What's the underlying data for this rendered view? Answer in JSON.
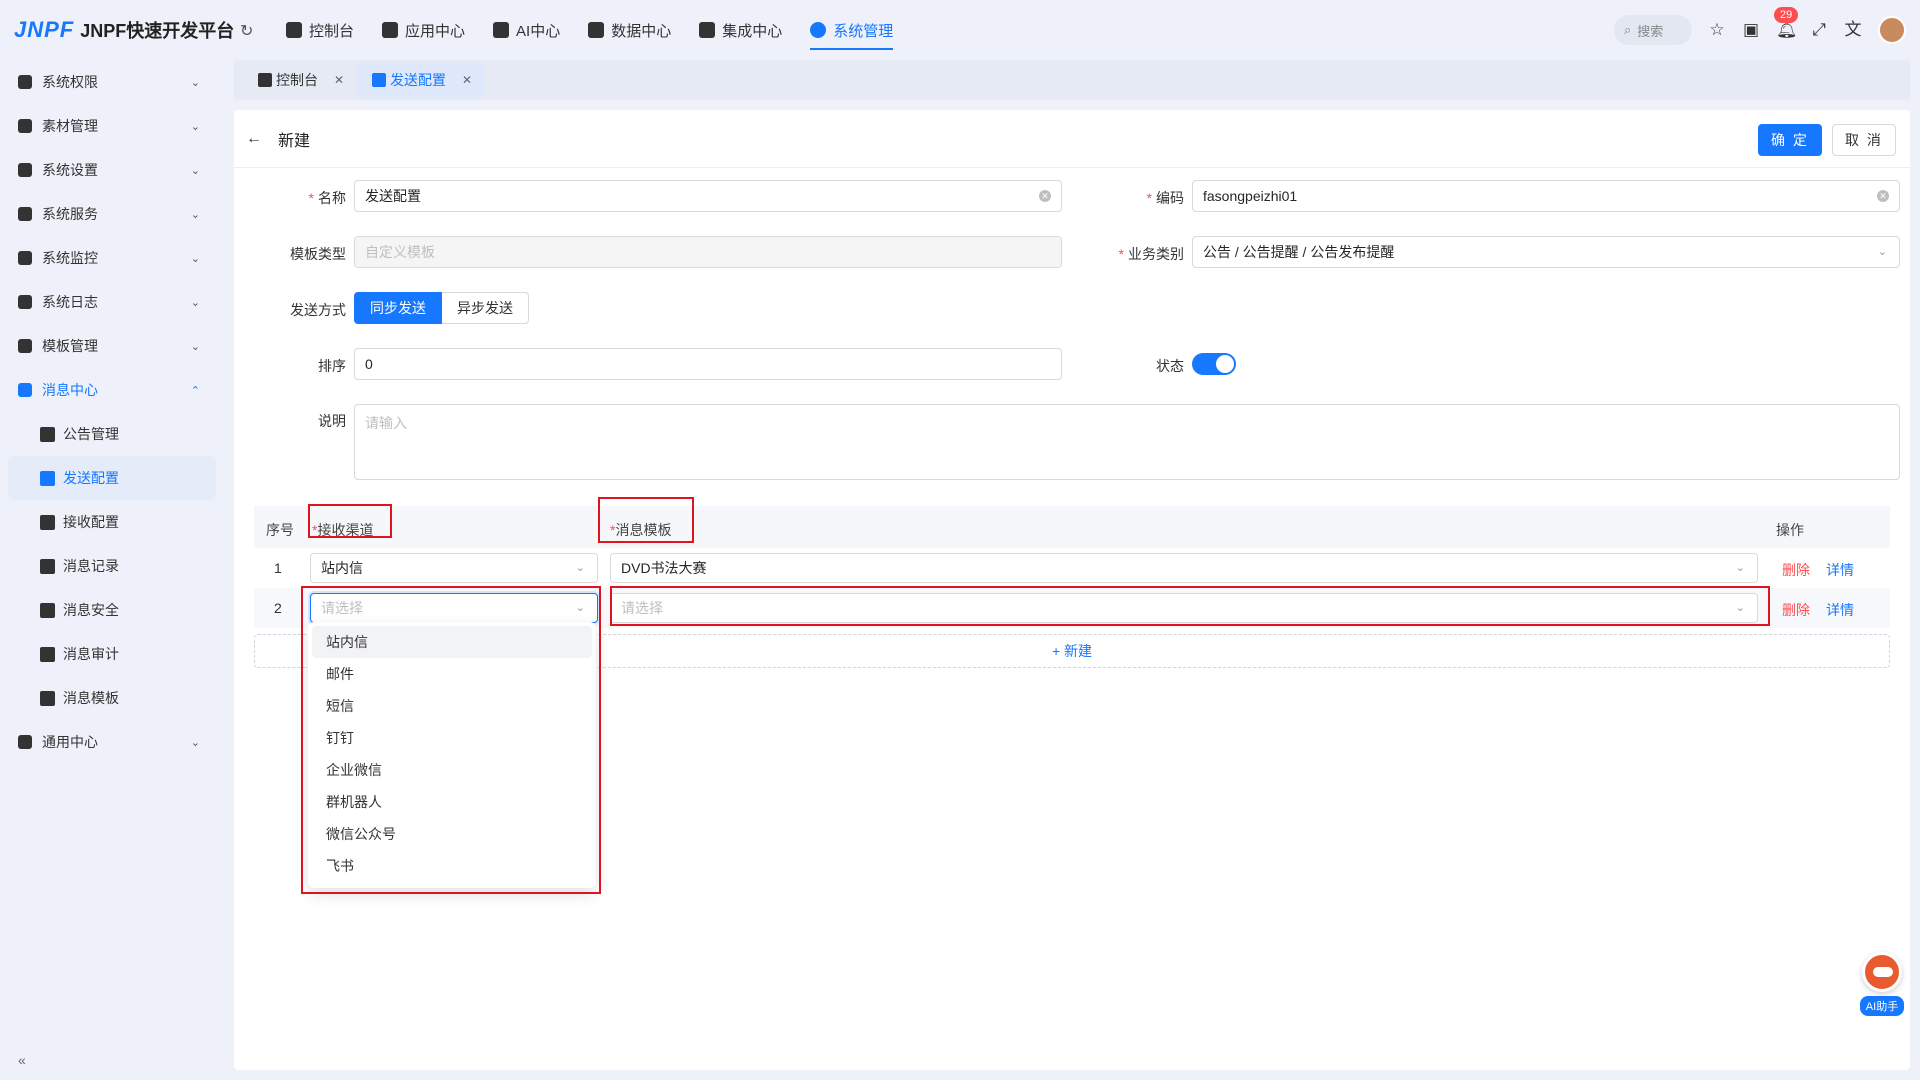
{
  "app": {
    "logo": "JNPF",
    "title": "JNPF快速开发平台"
  },
  "nav": [
    {
      "label": "控制台",
      "icon": "home-icon"
    },
    {
      "label": "应用中心",
      "icon": "app-grid-icon"
    },
    {
      "label": "AI中心",
      "icon": "ai-grid-icon"
    },
    {
      "label": "数据中心",
      "icon": "database-icon"
    },
    {
      "label": "集成中心",
      "icon": "integration-icon"
    },
    {
      "label": "系统管理",
      "icon": "gear-icon",
      "active": true
    }
  ],
  "top_right": {
    "search_placeholder": "搜索",
    "notification_count": "29"
  },
  "sidebar": {
    "items": [
      {
        "label": "系统权限",
        "icon": "shield-icon"
      },
      {
        "label": "素材管理",
        "icon": "folder-icon"
      },
      {
        "label": "系统设置",
        "icon": "settings-icon"
      },
      {
        "label": "系统服务",
        "icon": "service-icon"
      },
      {
        "label": "系统监控",
        "icon": "monitor-icon"
      },
      {
        "label": "系统日志",
        "icon": "log-icon"
      },
      {
        "label": "模板管理",
        "icon": "template-icon"
      }
    ],
    "message_center": {
      "label": "消息中心",
      "icon": "message-icon"
    },
    "sub_items": [
      {
        "label": "公告管理",
        "icon": "announcement-icon"
      },
      {
        "label": "发送配置",
        "icon": "send-config-icon",
        "active": true
      },
      {
        "label": "接收配置",
        "icon": "receive-config-icon"
      },
      {
        "label": "消息记录",
        "icon": "record-icon"
      },
      {
        "label": "消息安全",
        "icon": "security-icon"
      },
      {
        "label": "消息审计",
        "icon": "audit-icon"
      },
      {
        "label": "消息模板",
        "icon": "message-template-icon"
      }
    ],
    "general": {
      "label": "通用中心",
      "icon": "general-icon"
    },
    "collapse": "«"
  },
  "tabs": [
    {
      "label": "控制台",
      "icon": "home-icon"
    },
    {
      "label": "发送配置",
      "icon": "send-config-icon",
      "active": true
    }
  ],
  "panel": {
    "title": "新建",
    "ok": "确 定",
    "cancel": "取 消"
  },
  "form": {
    "name_label": "名称",
    "name_value": "发送配置",
    "code_label": "编码",
    "code_value": "fasongpeizhi01",
    "template_type_label": "模板类型",
    "template_type_value": "自定义模板",
    "category_label": "业务类别",
    "category_value": "公告 / 公告提醒 / 公告发布提醒",
    "send_mode_label": "发送方式",
    "send_mode_sync": "同步发送",
    "send_mode_async": "异步发送",
    "sort_label": "排序",
    "sort_value": "0",
    "status_label": "状态",
    "status_on": true,
    "desc_label": "说明",
    "desc_placeholder": "请输入"
  },
  "table": {
    "headers": {
      "index": "序号",
      "channel": "接收渠道",
      "template": "消息模板",
      "action": "操作"
    },
    "rows": [
      {
        "index": "1",
        "channel": "站内信",
        "template": "DVD书法大赛",
        "delete": "删除",
        "detail": "详情"
      },
      {
        "index": "2",
        "channel_placeholder": "请选择",
        "template_placeholder": "请选择",
        "delete": "删除",
        "detail": "详情"
      }
    ],
    "add": "+ 新建"
  },
  "dropdown_options": [
    "站内信",
    "邮件",
    "短信",
    "钉钉",
    "企业微信",
    "群机器人",
    "微信公众号",
    "飞书"
  ],
  "ai_assistant": "AI助手",
  "colors": {
    "primary": "#1677ff",
    "danger": "#ff4d4f",
    "highlight_box": "#e0141e"
  }
}
